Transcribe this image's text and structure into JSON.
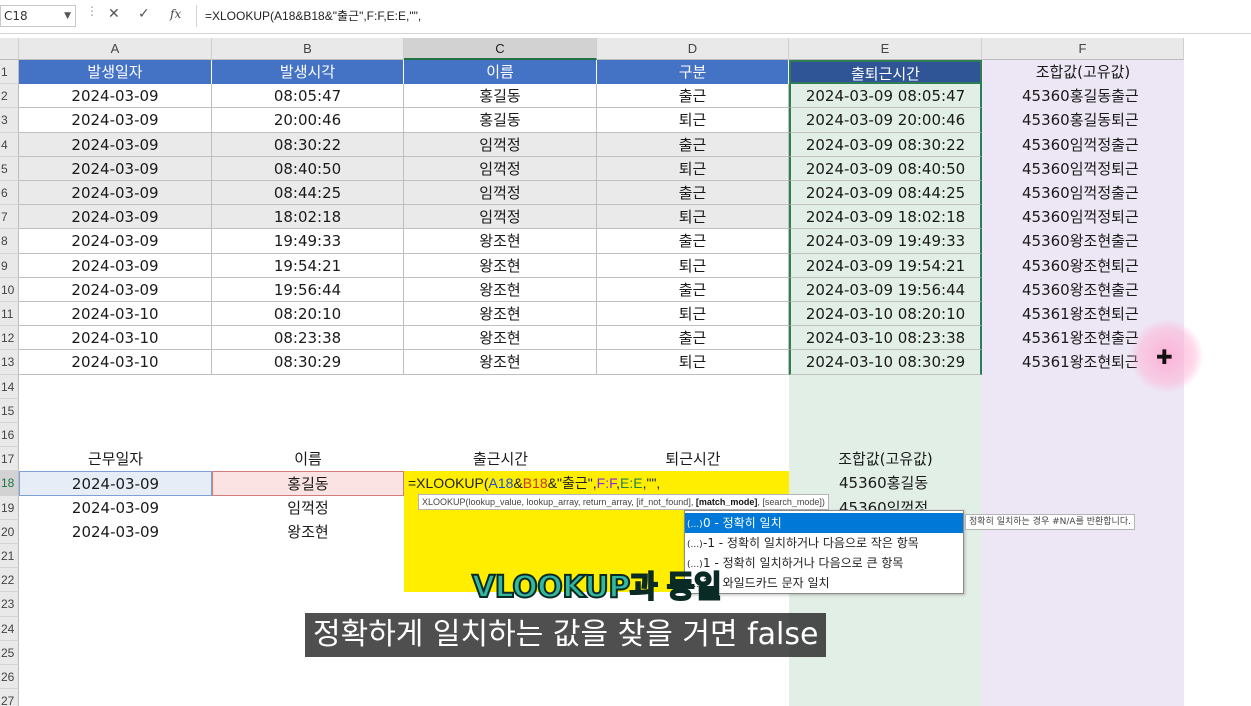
{
  "formula_bar": {
    "name_box": "C18",
    "formula": "=XLOOKUP(A18&B18&\"출근\",F:F,E:E,\"\","
  },
  "columns": [
    "A",
    "B",
    "C",
    "D",
    "E",
    "F"
  ],
  "rows": [
    "1",
    "2",
    "3",
    "4",
    "5",
    "6",
    "7",
    "8",
    "9",
    "10",
    "11",
    "12",
    "13",
    "14",
    "15",
    "16",
    "17",
    "18",
    "19",
    "20",
    "21",
    "22",
    "23",
    "24",
    "25",
    "26",
    "27"
  ],
  "table": {
    "headers": [
      "발생일자",
      "발생시각",
      "이름",
      "구분",
      "출퇴근시간",
      "조합값(고유값)"
    ],
    "data": [
      [
        "2024-03-09",
        "08:05:47",
        "홍길동",
        "출근",
        "2024-03-09 08:05:47",
        "45360홍길동출근"
      ],
      [
        "2024-03-09",
        "20:00:46",
        "홍길동",
        "퇴근",
        "2024-03-09 20:00:46",
        "45360홍길동퇴근"
      ],
      [
        "2024-03-09",
        "08:30:22",
        "임꺽정",
        "출근",
        "2024-03-09 08:30:22",
        "45360임꺽정출근"
      ],
      [
        "2024-03-09",
        "08:40:50",
        "임꺽정",
        "퇴근",
        "2024-03-09 08:40:50",
        "45360임꺽정퇴근"
      ],
      [
        "2024-03-09",
        "08:44:25",
        "임꺽정",
        "출근",
        "2024-03-09 08:44:25",
        "45360임꺽정출근"
      ],
      [
        "2024-03-09",
        "18:02:18",
        "임꺽정",
        "퇴근",
        "2024-03-09 18:02:18",
        "45360임꺽정퇴근"
      ],
      [
        "2024-03-09",
        "19:49:33",
        "왕조현",
        "출근",
        "2024-03-09 19:49:33",
        "45360왕조현출근"
      ],
      [
        "2024-03-09",
        "19:54:21",
        "왕조현",
        "퇴근",
        "2024-03-09 19:54:21",
        "45360왕조현퇴근"
      ],
      [
        "2024-03-09",
        "19:56:44",
        "왕조현",
        "출근",
        "2024-03-09 19:56:44",
        "45360왕조현출근"
      ],
      [
        "2024-03-10",
        "08:20:10",
        "왕조현",
        "퇴근",
        "2024-03-10 08:20:10",
        "45361왕조현퇴근"
      ],
      [
        "2024-03-10",
        "08:23:38",
        "왕조현",
        "출근",
        "2024-03-10 08:23:38",
        "45361왕조현출근"
      ],
      [
        "2024-03-10",
        "08:30:29",
        "왕조현",
        "퇴근",
        "2024-03-10 08:30:29",
        "45361왕조현퇴근"
      ]
    ]
  },
  "summary": {
    "headers": [
      "근무일자",
      "이름",
      "출근시간",
      "퇴근시간",
      "조합값(고유값)"
    ],
    "rows": [
      [
        "2024-03-09",
        "홍길동",
        "",
        "",
        "45360홍길동"
      ],
      [
        "2024-03-09",
        "임꺽정",
        "",
        "",
        "45360임꺽정"
      ],
      [
        "2024-03-09",
        "왕조현",
        "",
        "",
        ""
      ]
    ]
  },
  "cell_formula": {
    "prefix": "=XLOOKUP(",
    "ref1": "A18",
    "amp1": "&",
    "ref2": "B18",
    "literal": "&\"출근\",",
    "ref3": "F:F",
    "comma1": ",",
    "ref4": "E:E",
    "suffix": ",\"\","
  },
  "tooltip": {
    "head": "XLOOKUP(lookup_value, lookup_array, return_array, [if_not_found], ",
    "bold": "[match_mode]",
    "tail": ", [search_mode])"
  },
  "match_mode_options": [
    {
      "glyph": "(...)",
      "label": "0 - 정확히 일치",
      "active": true
    },
    {
      "glyph": "(...)",
      "label": "-1 - 정확히 일치하거나 다음으로 작은 항목",
      "active": false
    },
    {
      "glyph": "(...)",
      "label": "1 - 정확히 일치하거나 다음으로 큰 항목",
      "active": false
    },
    {
      "glyph": "(...)",
      "label": "2 - 와일드카드 문자 일치",
      "active": false
    }
  ],
  "option_description": "정확히 일치하는 경우 #N/A를 반환합니다.",
  "subtitles": {
    "top": "VLOOKUP과 동일",
    "bottom": "정확하게 일치하는 값을 찾을 거면 false"
  },
  "colors": {
    "header_blue": "#4472c4",
    "header_dark": "#2f5597",
    "formula_yellow": "#ffee00",
    "column_e_fill": "#e2efe6",
    "column_f_fill": "#ede6f4",
    "dropdown_active": "#0078d7",
    "subtitle_teal": "#33b7a0"
  }
}
